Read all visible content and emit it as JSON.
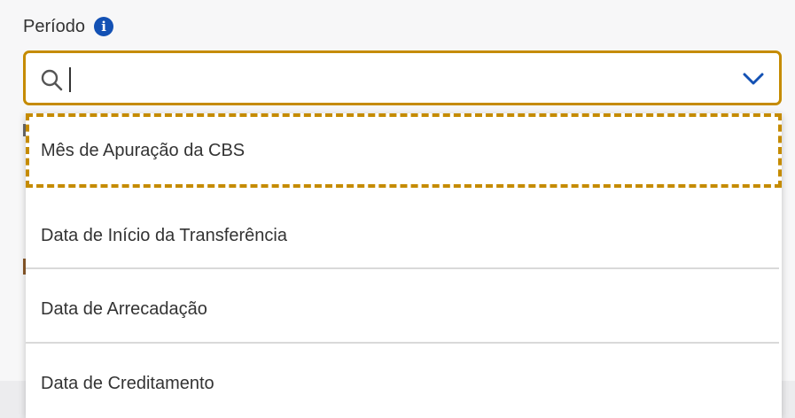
{
  "field": {
    "label": "Período",
    "info_icon": "info-icon"
  },
  "search": {
    "value": "",
    "placeholder": "",
    "search_icon": "search-icon",
    "toggle_icon": "chevron-down-icon"
  },
  "colors": {
    "focus": "#c58b00",
    "accent": "#1351b4",
    "text": "#333333",
    "divider": "#d9d9d9"
  },
  "options": [
    {
      "label": "Mês de Apuração da CBS",
      "focused": true
    },
    {
      "label": "Data de Início da Transferência",
      "focused": false
    },
    {
      "label": "Data de Arrecadação",
      "focused": false
    },
    {
      "label": "Data de Creditamento",
      "focused": false
    }
  ]
}
